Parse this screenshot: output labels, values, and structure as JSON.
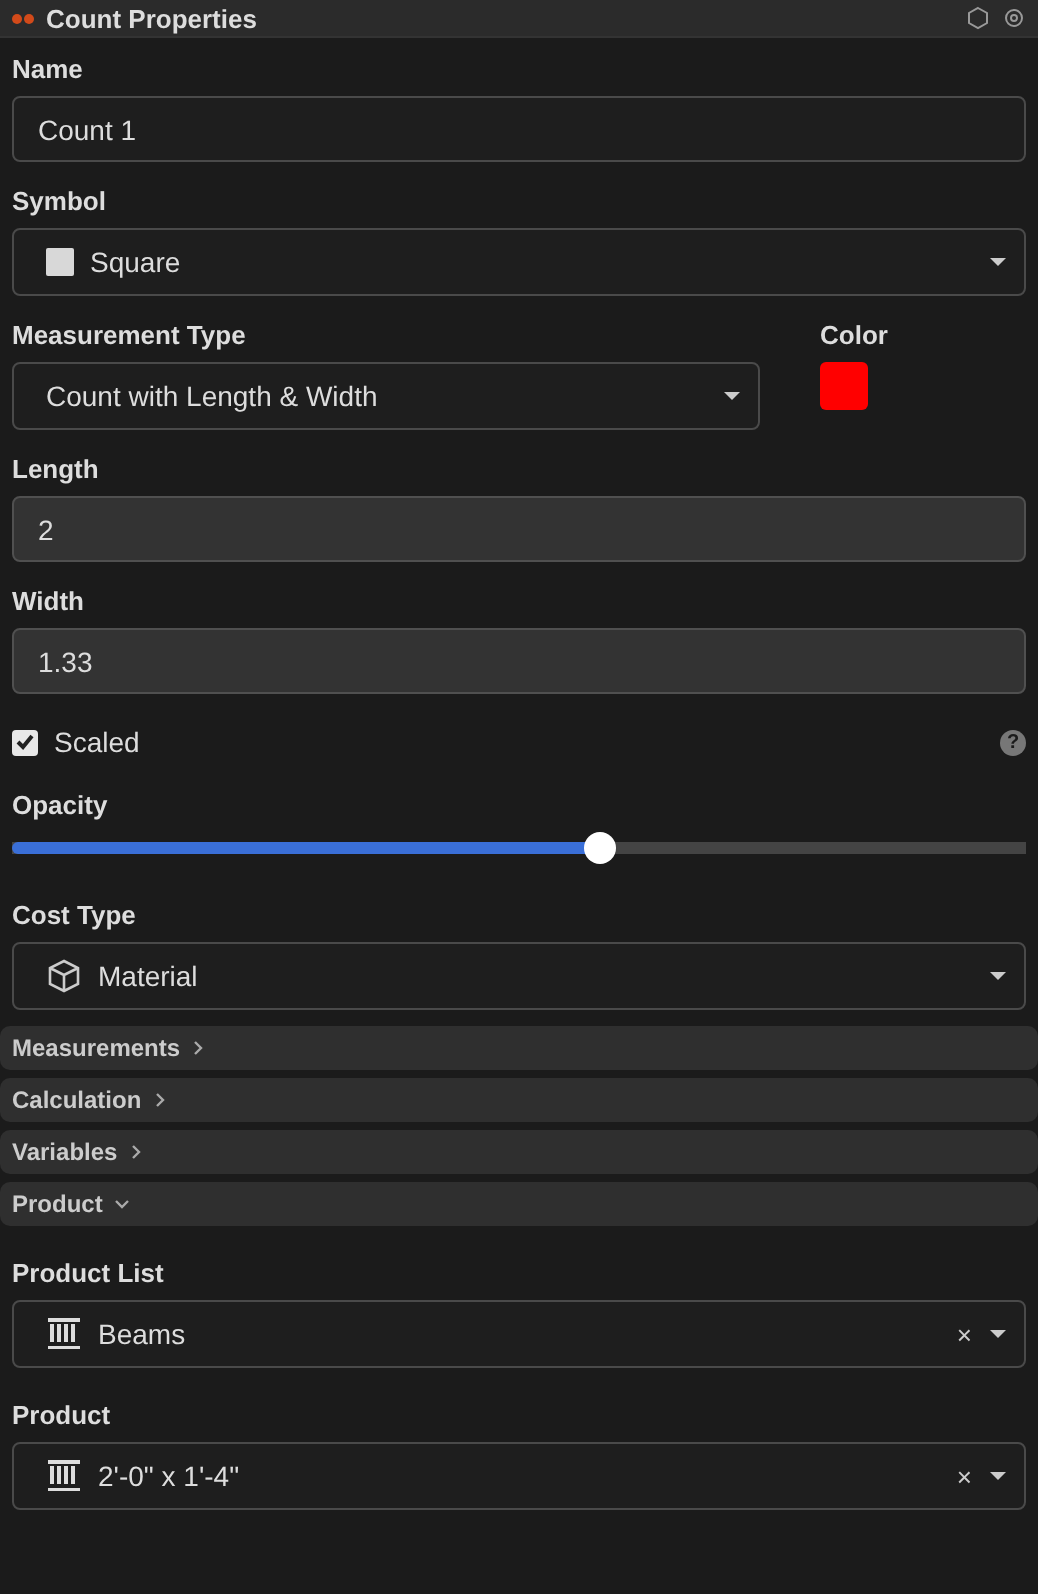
{
  "window": {
    "title": "Count Properties"
  },
  "fields": [
    {
      "kind": "text",
      "label": "Name",
      "value": "Count 1"
    },
    {
      "kind": "symbol_select",
      "label": "Symbol",
      "value": "Square"
    },
    {
      "kind": "select_color",
      "label": "Measurement Type",
      "value": "Count with Length & Width",
      "color_label": "Color",
      "color": "#ff0000"
    },
    {
      "kind": "number",
      "label": "Length",
      "value": "2"
    },
    {
      "kind": "number",
      "label": "Width",
      "value": "1.33"
    },
    {
      "kind": "checkbox",
      "label": "Scaled",
      "checked": true,
      "help": "?"
    },
    {
      "kind": "slider",
      "label": "Opacity",
      "level": 0.58
    },
    {
      "kind": "cost_select",
      "label": "Cost Type",
      "value": "Material"
    }
  ],
  "sections": [
    {
      "title": "Measurements",
      "expanded": false
    },
    {
      "title": "Calculation",
      "expanded": false
    },
    {
      "title": "Variables",
      "expanded": false
    },
    {
      "title": "Product",
      "expanded": true,
      "fields": [
        {
          "kind": "product_select",
          "label": "Product List",
          "value": "Beams",
          "clear": "×"
        },
        {
          "kind": "product_select",
          "label": "Product",
          "value": "2'-0\" x 1'-4\"",
          "clear": "×"
        }
      ]
    }
  ]
}
